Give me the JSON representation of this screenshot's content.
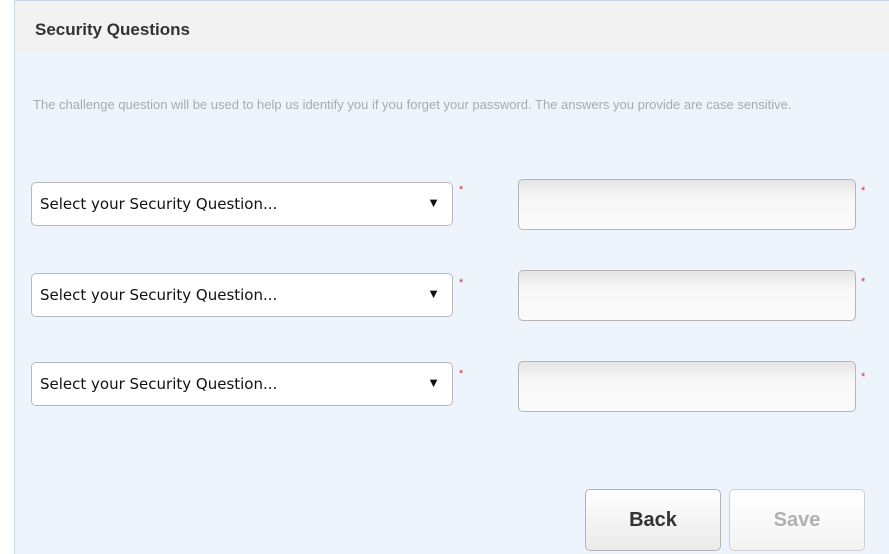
{
  "section": {
    "title": "Security Questions",
    "instructions": "The challenge question will be used to help us identify you if you forget your password. The answers you provide are case sensitive."
  },
  "questions": [
    {
      "select_placeholder": "Select your Security Question...",
      "required_marker": "*",
      "answer_value": ""
    },
    {
      "select_placeholder": "Select your Security Question...",
      "required_marker": "*",
      "answer_value": ""
    },
    {
      "select_placeholder": "Select your Security Question...",
      "required_marker": "*",
      "answer_value": ""
    }
  ],
  "icons": {
    "dropdown_arrow": "▼"
  },
  "actions": {
    "back_label": "Back",
    "save_label": "Save",
    "save_enabled": false
  },
  "colors": {
    "panel_background": "#eef4fb",
    "header_background": "#f2f2f2",
    "instruction_text": "#a3acb6",
    "required_marker": "#e03030",
    "disabled_text": "#b0b0b0"
  }
}
